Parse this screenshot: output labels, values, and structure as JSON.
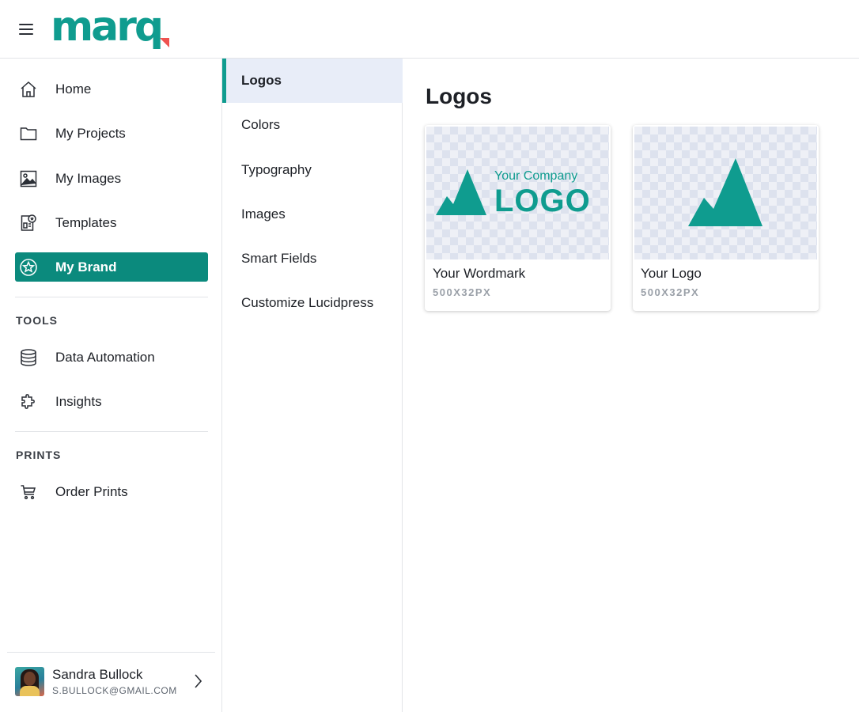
{
  "header": {
    "brand": "marq"
  },
  "sidebar": {
    "items": [
      {
        "label": "Home",
        "icon": "home-icon"
      },
      {
        "label": "My Projects",
        "icon": "folder-icon"
      },
      {
        "label": "My Images",
        "icon": "image-icon"
      },
      {
        "label": "Templates",
        "icon": "templates-icon"
      },
      {
        "label": "My Brand",
        "icon": "star-badge-icon",
        "active": true
      }
    ],
    "tools_label": "TOOLS",
    "tools": [
      {
        "label": "Data Automation",
        "icon": "database-icon"
      },
      {
        "label": "Insights",
        "icon": "puzzle-icon"
      }
    ],
    "prints_label": "PRINTS",
    "prints": [
      {
        "label": "Order Prints",
        "icon": "cart-icon"
      }
    ]
  },
  "user": {
    "name": "Sandra Bullock",
    "email": "S.BULLOCK@GMAIL.COM"
  },
  "brand_nav": {
    "items": [
      {
        "label": "Logos",
        "active": true
      },
      {
        "label": "Colors"
      },
      {
        "label": "Typography"
      },
      {
        "label": "Images"
      },
      {
        "label": "Smart Fields"
      },
      {
        "label": "Customize Lucidpress"
      }
    ]
  },
  "main": {
    "title": "Logos",
    "cards": [
      {
        "name": "Your Wordmark",
        "size": "500X32PX",
        "preview_line1": "Your Company",
        "preview_line2": "LOGO"
      },
      {
        "name": "Your Logo",
        "size": "500X32PX"
      }
    ]
  },
  "colors": {
    "accent": "#0f9c8f",
    "active_nav": "#0b8a7d",
    "logo_mark": "#ef5350"
  }
}
